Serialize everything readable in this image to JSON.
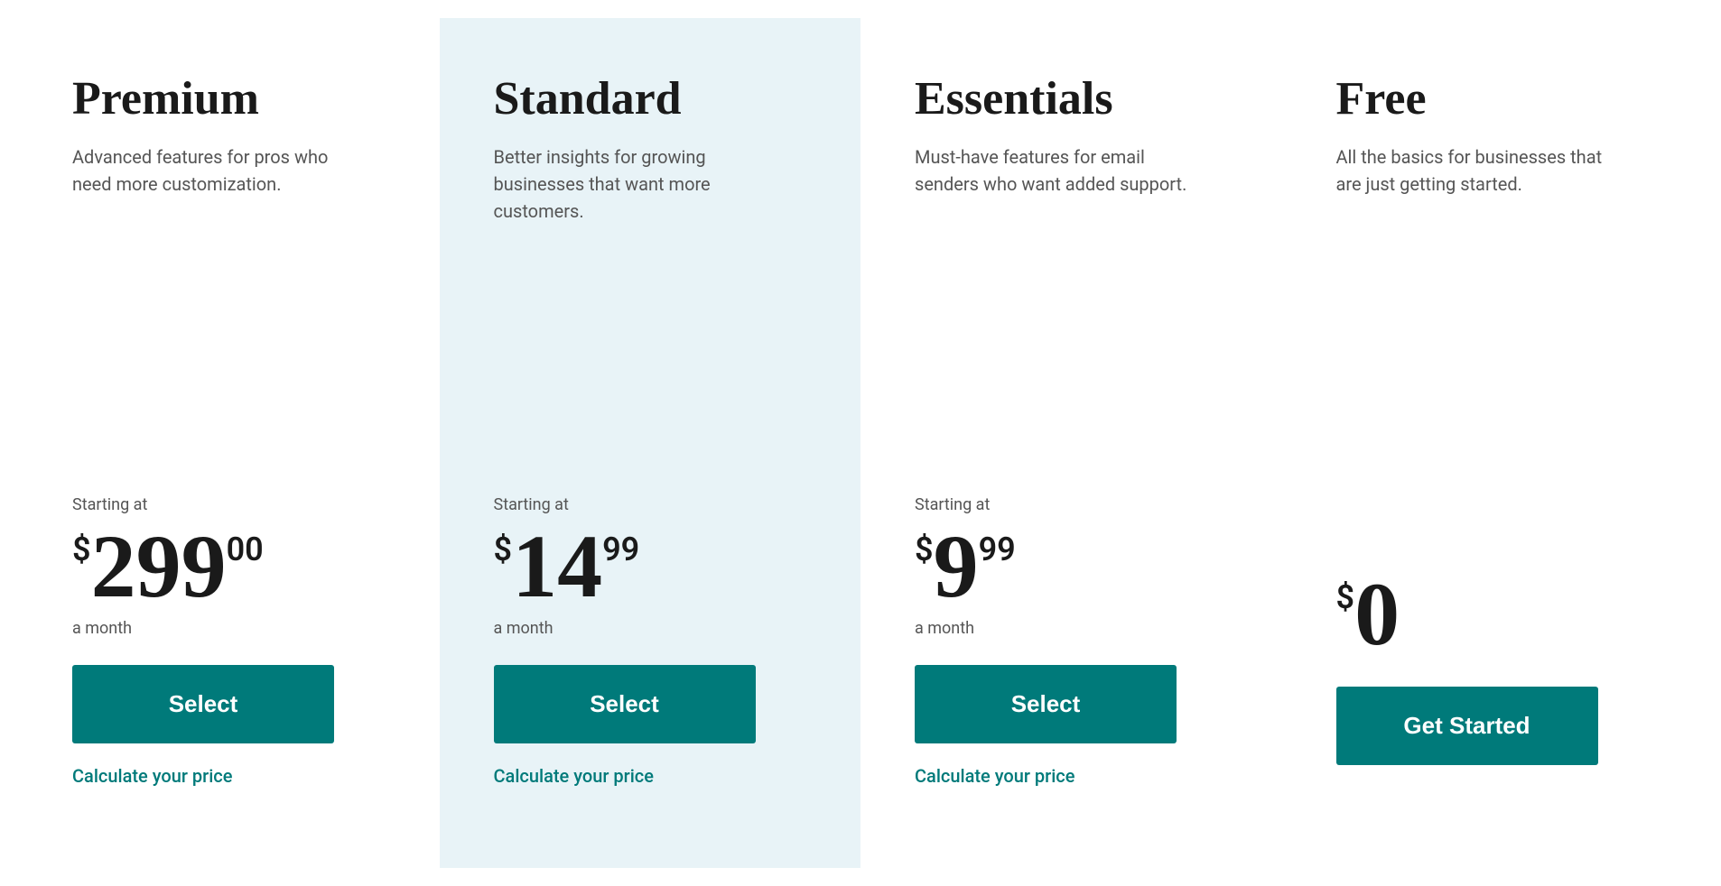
{
  "plans": [
    {
      "id": "premium",
      "name": "Premium",
      "description": "Advanced features for pros who need more customization.",
      "starting_at_label": "Starting at",
      "price_dollar": "$",
      "price_main": "299",
      "price_cents": "00",
      "price_period": "a month",
      "button_label": "Select",
      "calculate_label": "Calculate your price",
      "highlighted": false
    },
    {
      "id": "standard",
      "name": "Standard",
      "description": "Better insights for growing businesses that want more customers.",
      "starting_at_label": "Starting at",
      "price_dollar": "$",
      "price_main": "14",
      "price_cents": "99",
      "price_period": "a month",
      "button_label": "Select",
      "calculate_label": "Calculate your price",
      "highlighted": true
    },
    {
      "id": "essentials",
      "name": "Essentials",
      "description": "Must-have features for email senders who want added support.",
      "starting_at_label": "Starting at",
      "price_dollar": "$",
      "price_main": "9",
      "price_cents": "99",
      "price_period": "a month",
      "button_label": "Select",
      "calculate_label": "Calculate your price",
      "highlighted": false
    },
    {
      "id": "free",
      "name": "Free",
      "description": "All the basics for businesses that are just getting started.",
      "starting_at_label": "",
      "price_dollar": "$",
      "price_main": "0",
      "price_cents": "",
      "price_period": "",
      "button_label": "Get Started",
      "calculate_label": "",
      "highlighted": false
    }
  ],
  "colors": {
    "button_bg": "#007a7a",
    "highlight_bg": "#e8f3f7",
    "link_color": "#007a7a"
  }
}
